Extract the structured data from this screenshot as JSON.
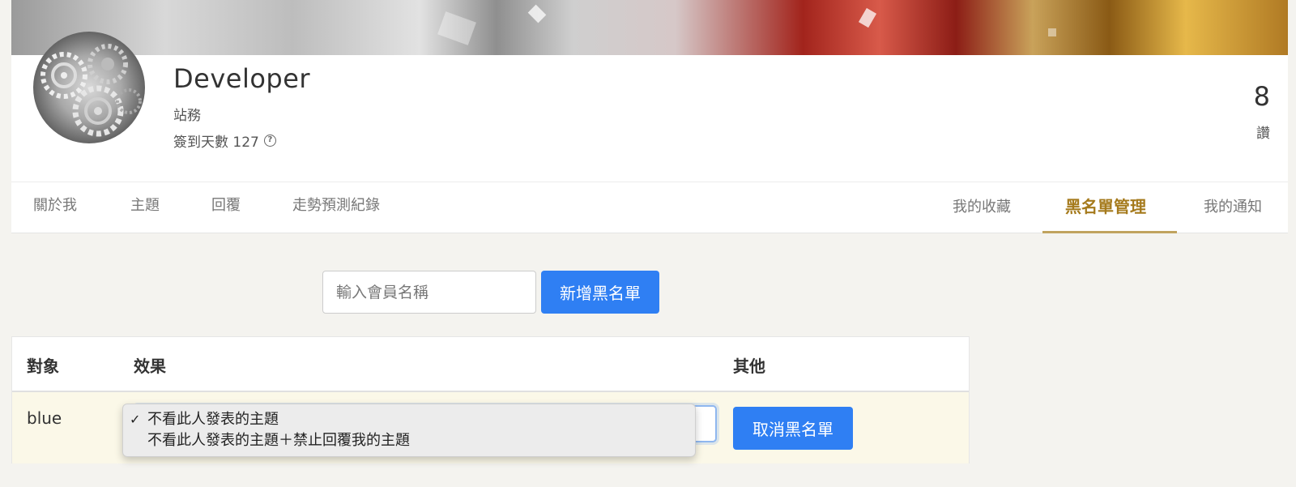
{
  "profile": {
    "name": "Developer",
    "role": "站務",
    "checkin_label": "簽到天數 127",
    "help_icon": "?",
    "stat_value": "8",
    "stat_label": "讚"
  },
  "tabs": {
    "left": [
      "關於我",
      "主題",
      "回覆",
      "走勢預測紀錄"
    ],
    "right": [
      "我的收藏",
      "黑名單管理",
      "我的通知"
    ],
    "active": "黑名單管理"
  },
  "add_blacklist": {
    "input_placeholder": "輸入會員名稱",
    "button_label": "新增黑名單"
  },
  "table": {
    "headers": [
      "對象",
      "效果",
      "其他"
    ],
    "rows": [
      {
        "target": "blue",
        "effect_options": [
          "不看此人發表的主題",
          "不看此人發表的主題＋禁止回覆我的主題"
        ],
        "selected_option": "不看此人發表的主題",
        "action_label": "取消黑名單"
      }
    ]
  },
  "colors": {
    "accent": "#2f7ff3",
    "active_tab": "#a57a1c",
    "tab_underline": "#c0a35e",
    "row_highlight": "#fbf8e8"
  }
}
